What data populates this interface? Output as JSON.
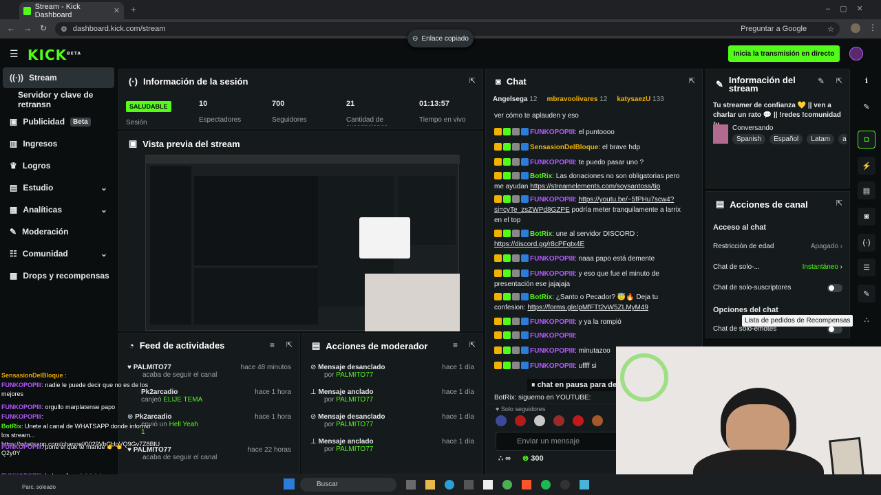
{
  "browser": {
    "tab_title": "Stream - Kick Dashboard",
    "url": "dashboard.kick.com/stream",
    "toast": "Enlace copiado",
    "ask_google": "Preguntar a Google"
  },
  "header": {
    "logo": "KICK",
    "logo_sup": "BETA",
    "start_button": "Inicia la transmisión en directo"
  },
  "sidebar": {
    "items": [
      {
        "label": "Stream"
      },
      {
        "label": "Servidor y clave de retransn"
      },
      {
        "label": "Publicidad",
        "badge": "Beta"
      },
      {
        "label": "Ingresos"
      },
      {
        "label": "Logros"
      },
      {
        "label": "Estudio"
      },
      {
        "label": "Analíticas"
      },
      {
        "label": "Moderación"
      },
      {
        "label": "Comunidad"
      },
      {
        "label": "Drops y recompensas"
      }
    ]
  },
  "session": {
    "title": "Información de la sesión",
    "status": "SALUDABLE",
    "status_label": "Sesión",
    "stats": [
      {
        "value": "10",
        "label": "Espectadores"
      },
      {
        "value": "700",
        "label": "Seguidores"
      },
      {
        "value": "21",
        "label": "Cantidad de suscripciones"
      },
      {
        "value": "01:13:57",
        "label": "Tiempo en vivo"
      }
    ]
  },
  "preview": {
    "title": "Vista previa del stream"
  },
  "activity": {
    "title": "Feed de actividades",
    "items": [
      {
        "name": "PALMITO77",
        "time": "hace 48 minutos",
        "desc": "acaba de seguir el canal",
        "extra": ""
      },
      {
        "name": "Pk2arcadio",
        "time": "hace 1 hora",
        "desc": "canjeó",
        "extra": "ELIJE TEMA"
      },
      {
        "name": "Pk2arcadio",
        "time": "hace 1 hora",
        "desc": "envió un",
        "extra": "Hell Yeah",
        "count": "1"
      },
      {
        "name": "PALMITO77",
        "time": "hace 22 horas",
        "desc": "acaba de seguir el canal",
        "extra": ""
      }
    ]
  },
  "modactions": {
    "title": "Acciones de moderador",
    "items": [
      {
        "action": "Mensaje desanclado",
        "by": "por",
        "user": "PALMITO77",
        "time": "hace 1 día"
      },
      {
        "action": "Mensaje anclado",
        "by": "por",
        "user": "PALMITO77",
        "time": "hace 1 día"
      },
      {
        "action": "Mensaje desanclado",
        "by": "por",
        "user": "PALMITO77",
        "time": "hace 1 día"
      },
      {
        "action": "Mensaje anclado",
        "by": "por",
        "user": "PALMITO77",
        "time": "hace 1 día"
      }
    ]
  },
  "chat": {
    "title": "Chat",
    "top": [
      {
        "name": "Angelsega",
        "n": "12"
      },
      {
        "name": "mbravoolivares",
        "n": "12"
      },
      {
        "name": "katysaezU",
        "n": "133"
      }
    ],
    "top_text": "ver cómo te aplauden y eso",
    "messages": [
      {
        "user": "FUNKOPOPIII",
        "text": ": el puntoooo"
      },
      {
        "user": "SensasionDelBloque",
        "text": ": el brave hdp",
        "color": "y"
      },
      {
        "user": "FUNKOPOPIII",
        "text": ": te puedo pasar uno ?"
      },
      {
        "user": "BotRix",
        "text": ": Las donaciones no son obligatorias pero me ayudan ",
        "link": "https://streamelements.com/soysantoss/tip",
        "color": "g"
      },
      {
        "user": "FUNKOPOPIII",
        "text": ": ",
        "link": "https://youtu.be/~5fPHu7scw4?si=cyTe_zsZWPd8GZPE",
        "text2": " podría meter tranquilamente a larrix en el top"
      },
      {
        "user": "BotRix",
        "text": ": une al servidor DISCORD : ",
        "link": "https://discord.gg/r8cPFqtx4E",
        "color": "g"
      },
      {
        "user": "FUNKOPOPIII",
        "text": ": naaa papo está demente"
      },
      {
        "user": "FUNKOPOPIII",
        "text": ": y eso que fue el minuto de presentación ese jajajaja"
      },
      {
        "user": "BotRix",
        "text": ": ¿Santo o Pecador? 😇🔥 Deja tu confesion: ",
        "link": "https://forms.gle/pMfFTt2vW5ZLMyM49",
        "color": "g"
      },
      {
        "user": "FUNKOPOPIII",
        "text": ": y ya la rompió"
      },
      {
        "user": "FUNKOPOPIII",
        "text": ":"
      },
      {
        "user": "FUNKOPOPIII",
        "text": ": minutazoo"
      },
      {
        "user": "FUNKOPOPIII",
        "text": ": uffff si"
      }
    ],
    "paused": "chat en pausa para des",
    "bottom_bot": "BotRix: siguemo en YOUTUBE:",
    "followers_only": "Solo seguidores",
    "input_placeholder": "Enviar un mensaje",
    "infinity": "∞",
    "points": "300"
  },
  "streaminfo": {
    "title": "Información del stream",
    "desc": "Tu streamer de confianza 💛 || ven a charlar un rato 💬 || !redes !comunidad !v",
    "category": "Conversando",
    "tags": [
      "Spanish",
      "Español",
      "Latam",
      "ar"
    ]
  },
  "channel": {
    "title": "Acciones de canal",
    "access_title": "Acceso al chat",
    "rows": [
      {
        "label": "Restricción de edad",
        "value": "Apagado"
      },
      {
        "label": "Chat de solo-...",
        "value": "Instantáneo"
      },
      {
        "label": "Chat de solo-suscriptores",
        "value": ""
      }
    ],
    "options_title": "Opciones del chat",
    "tooltip": "Lista de pedidos de Recompensas",
    "emotes": "Chat de solo-emotes"
  },
  "overlay": [
    {
      "user": "SensasionDelBloque",
      "text": " :"
    },
    {
      "user": "FUNKOPOPIII",
      "text": ": nadie le puede decir que no es de los mejores"
    },
    {
      "user": "FUNKOPOPIII",
      "text": ": orgullo marplatense papo"
    },
    {
      "user": "FUNKOPOPIII",
      "text": ":"
    },
    {
      "user": "BotRix",
      "text": ": Unete al canal de WHATSAPP donde informo los stream... https://whatsapp.com/channel/0029VbCHqVQ9Gv7Z8BlU Q2y0Y"
    },
    {
      "user": "FUNKOPOPIII",
      "text": ": pone el que te mandé 👉👈"
    },
    {
      "user": "FUNKOPOPIII",
      "text": ": holaaa Juan jajajajaja"
    }
  ],
  "taskbar": {
    "search": "Buscar",
    "left_text": "Parc. soleado"
  },
  "colors": {
    "accent": "#53fc18",
    "panel": "#151a1c",
    "bg": "#0b0e0f"
  }
}
